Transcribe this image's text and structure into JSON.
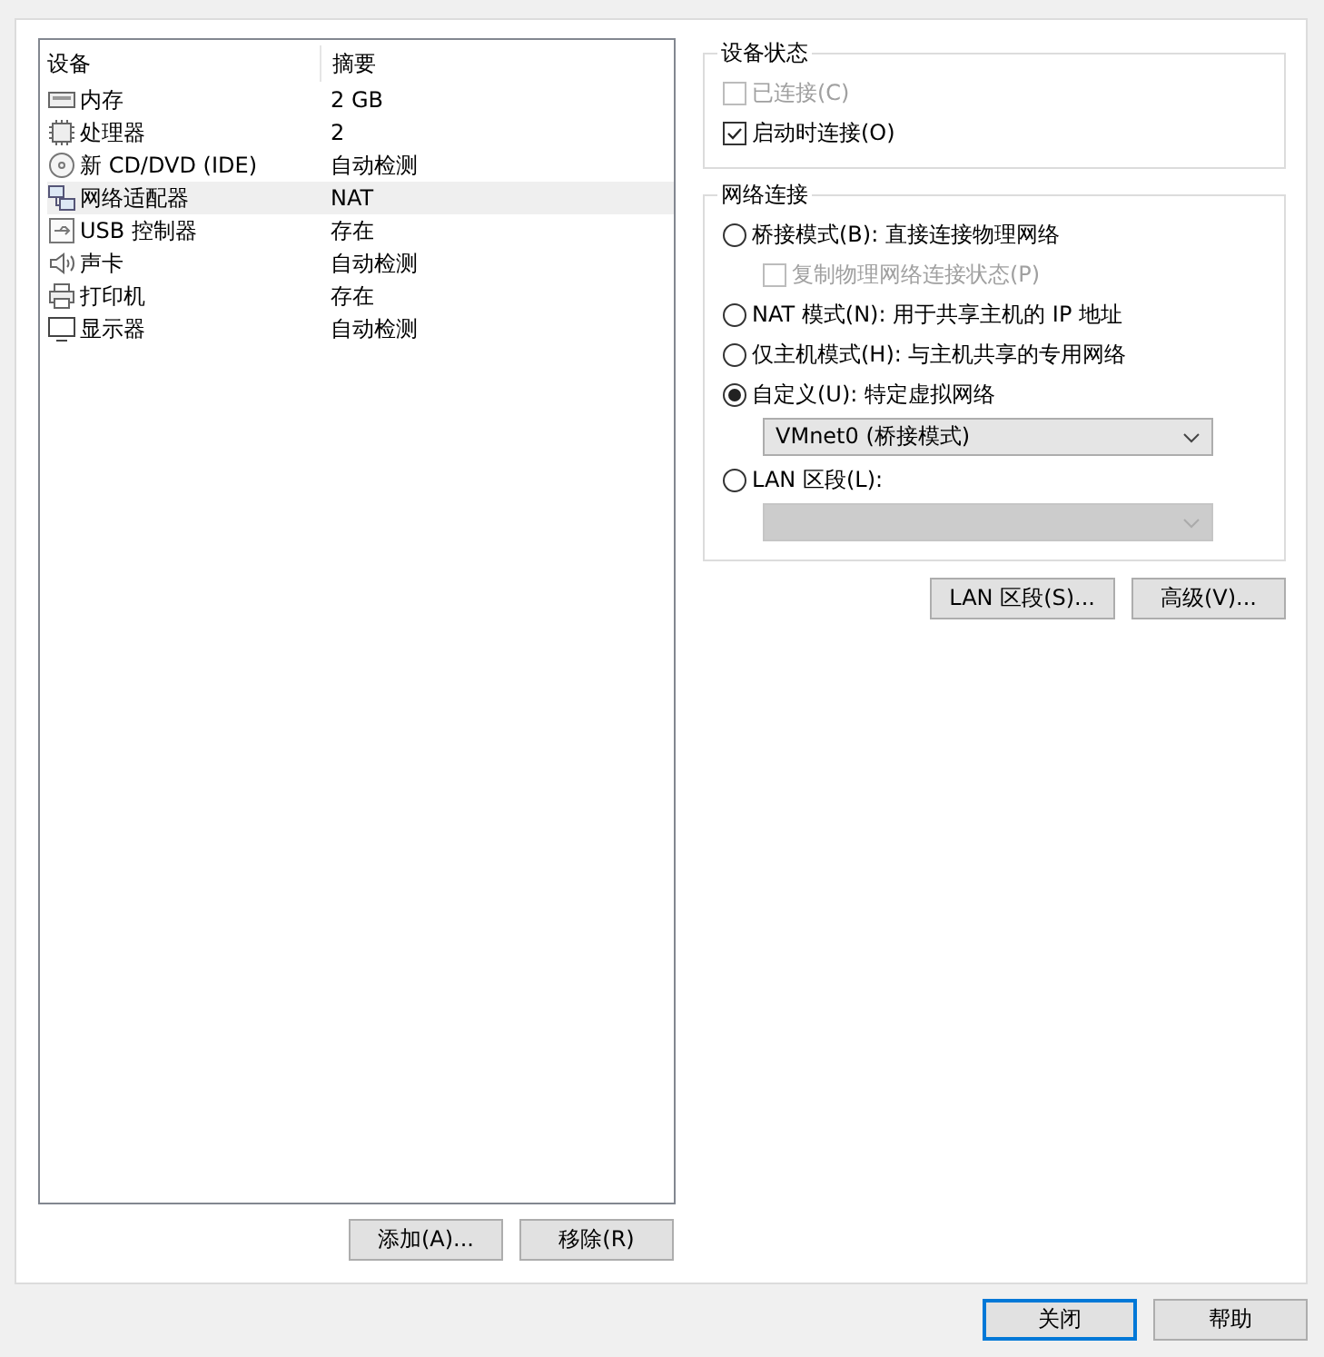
{
  "device_list": {
    "columns": [
      "设备",
      "摘要"
    ],
    "rows": [
      {
        "kind": "memory",
        "name": "内存",
        "summary": "2 GB",
        "selected": false
      },
      {
        "kind": "cpu",
        "name": "处理器",
        "summary": "2",
        "selected": false
      },
      {
        "kind": "disc",
        "name": "新 CD/DVD (IDE)",
        "summary": "自动检测",
        "selected": false
      },
      {
        "kind": "network",
        "name": "网络适配器",
        "summary": "NAT",
        "selected": true
      },
      {
        "kind": "usb",
        "name": "USB 控制器",
        "summary": "存在",
        "selected": false
      },
      {
        "kind": "sound",
        "name": "声卡",
        "summary": "自动检测",
        "selected": false
      },
      {
        "kind": "printer",
        "name": "打印机",
        "summary": "存在",
        "selected": false
      },
      {
        "kind": "display",
        "name": "显示器",
        "summary": "自动检测",
        "selected": false
      }
    ],
    "buttons": [
      "添加(A)...",
      "移除(R)"
    ]
  },
  "device_status": {
    "title": "设备状态",
    "checkboxes": [
      {
        "label": "已连接(C)",
        "checked": false,
        "disabled": true
      },
      {
        "label": "启动时连接(O)",
        "checked": true,
        "disabled": false
      }
    ]
  },
  "network_connection": {
    "title": "网络连接",
    "options": [
      {
        "kind": "radio",
        "label": "桥接模式(B): 直接连接物理网络",
        "selected": false,
        "disabled": false
      },
      {
        "kind": "checkbox",
        "label": "复制物理网络连接状态(P)",
        "checked": false,
        "disabled": true
      },
      {
        "kind": "radio",
        "label": "NAT 模式(N): 用于共享主机的 IP 地址",
        "selected": false,
        "disabled": false
      },
      {
        "kind": "radio",
        "label": "仅主机模式(H): 与主机共享的专用网络",
        "selected": false,
        "disabled": false
      },
      {
        "kind": "radio",
        "label": "自定义(U): 特定虚拟网络",
        "selected": true,
        "disabled": false
      },
      {
        "kind": "select",
        "value": "VMnet0 (桥接模式)",
        "disabled": false
      },
      {
        "kind": "radio",
        "label": "LAN 区段(L):",
        "selected": false,
        "disabled": false
      },
      {
        "kind": "select",
        "disabled": true
      }
    ]
  },
  "panel_buttons": [
    "LAN 区段(S)...",
    "高级(V)..."
  ],
  "dialog_buttons": [
    {
      "label": "关闭",
      "default": true
    },
    {
      "label": "帮助",
      "default": false
    }
  ]
}
